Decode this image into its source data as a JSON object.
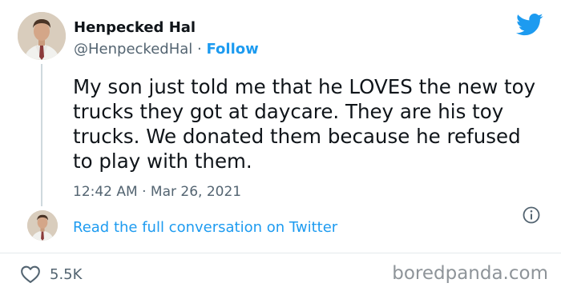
{
  "author": {
    "display_name": "Henpecked Hal",
    "handle": "@HenpeckedHal",
    "separator": "·",
    "follow_label": "Follow"
  },
  "tweet": {
    "text": "My son just told me that he LOVES the new toy trucks they got at daycare. They are his toy trucks. We donated them because he refused to play with them.",
    "time": "12:42 AM",
    "dot": "·",
    "date": "Mar 26, 2021"
  },
  "conversation": {
    "read_label": "Read the full conversation on Twitter"
  },
  "actions": {
    "like_count": "5.5K"
  },
  "watermark": "boredpanda.com",
  "icons": {
    "brand": "twitter-bird-icon",
    "info": "info-icon",
    "like": "heart-icon"
  },
  "colors": {
    "accent": "#1d9bf0",
    "text": "#0f1419",
    "muted": "#536471",
    "watermark": "#8e9499"
  }
}
